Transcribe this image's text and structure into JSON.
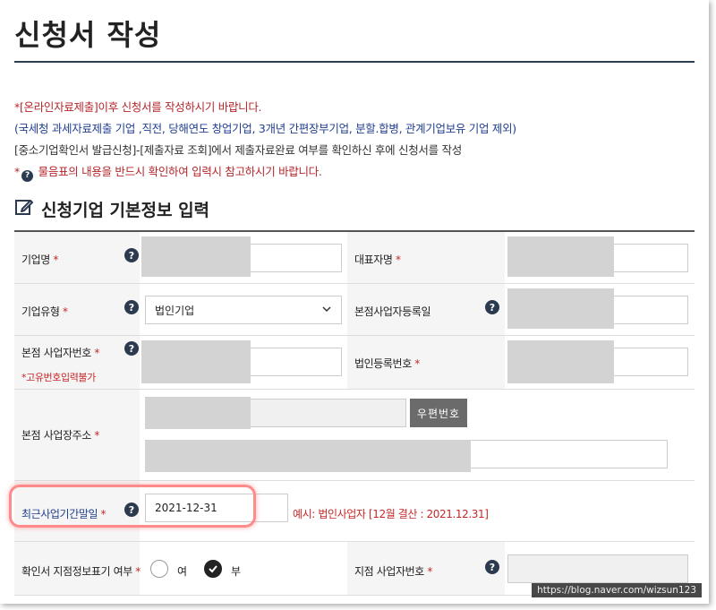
{
  "page": {
    "title": "신청서 작성"
  },
  "notices": [
    "*[온라인자료제출]이후 신청서를 작성하시기 바랍니다.",
    "(국세청 과세자료제출 기업 ,직전, 당해연도 창업기업, 3개년 간편장부기업, 분할.합병, 관계기업보유 기업 제외)",
    "[중소기업확인서 발급신청]-[제출자료 조회]에서 제출자료완료 여부를 확인하신 후에 신청서를 작성",
    "물음표의 내용을 반드시 확인하여 입력시 참고하시기 바랍니다."
  ],
  "notice4_prefix": "*",
  "section": {
    "title": "신청기업 기본정보 입력",
    "icon": "edit-icon"
  },
  "required_mark": "*",
  "help_glyph": "?",
  "fields": {
    "company_name": {
      "label": "기업명"
    },
    "ceo_name": {
      "label": "대표자명"
    },
    "company_type": {
      "label": "기업유형",
      "value": "법인기업"
    },
    "hq_reg_date": {
      "label": "본점사업자등록일"
    },
    "hq_biz_number": {
      "label": "본점 사업자번호",
      "warning": "*고유번호입력불가"
    },
    "corp_reg_number": {
      "label": "법인등록번호"
    },
    "hq_address": {
      "label": "본점 사업장주소",
      "zip_button": "우편번호"
    },
    "fiscal_end_date": {
      "label": "최근사업기간말일",
      "value": "2021-12-31",
      "example": "예시: 법인사업자 [12월 결산 : 2021.12.31]"
    },
    "branch_info": {
      "label": "확인서 지점정보표기 여부",
      "options": [
        "여",
        "부"
      ],
      "selected": "부"
    },
    "branch_biz_number": {
      "label": "지점 사업자번호"
    }
  },
  "watermark": "https://blog.naver.com/wizsun123",
  "colors": {
    "accent_red": "#c62828",
    "accent_blue": "#213f8f",
    "title_rule": "#2d3f55",
    "highlight": "#ff8a8a"
  }
}
